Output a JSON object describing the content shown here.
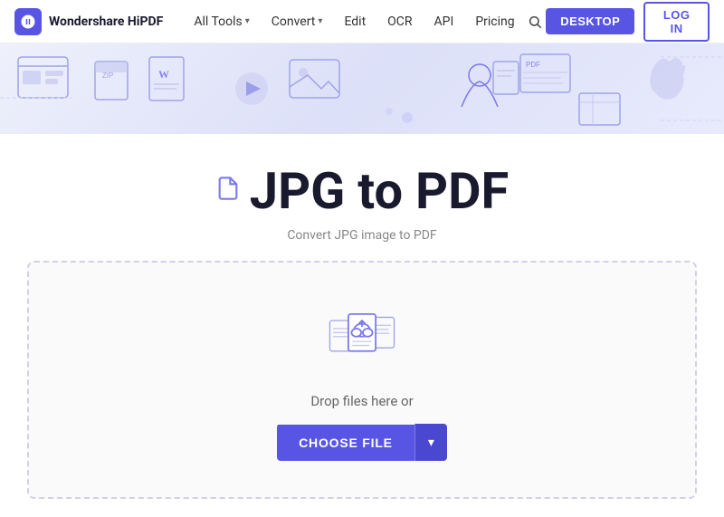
{
  "navbar": {
    "logo_text": "Wondershare HiPDF",
    "nav_items": [
      {
        "label": "All Tools",
        "has_arrow": true
      },
      {
        "label": "Convert",
        "has_arrow": true
      },
      {
        "label": "Edit",
        "has_arrow": false
      },
      {
        "label": "OCR",
        "has_arrow": false
      },
      {
        "label": "API",
        "has_arrow": false
      },
      {
        "label": "Pricing",
        "has_arrow": false
      }
    ],
    "desktop_btn": "DESKTOP",
    "login_btn": "LOG IN"
  },
  "main": {
    "title": "JPG to PDF",
    "subtitle": "Convert JPG image to PDF",
    "drop_text": "Drop files here or",
    "choose_file_label": "CHOOSE FILE",
    "choose_arrow": "▾"
  },
  "colors": {
    "accent": "#5855e5",
    "text_primary": "#1a1a2e",
    "text_secondary": "#888"
  }
}
